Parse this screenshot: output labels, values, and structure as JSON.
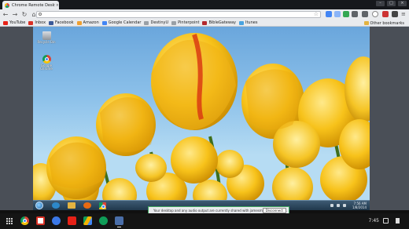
{
  "browser": {
    "tab_title": "Chrome Remote Deskto",
    "tab_close": "×",
    "window_buttons": [
      "–",
      "□",
      "×"
    ],
    "nav": {
      "back": "←",
      "forward": "→",
      "reload": "↻",
      "home": "⌂"
    },
    "address_value": "",
    "star": "☆"
  },
  "bookmarks": [
    {
      "label": "YouTube",
      "color": "#e62117"
    },
    {
      "label": "Inbox",
      "color": "#d93025"
    },
    {
      "label": "Facebook",
      "color": "#3b5998"
    },
    {
      "label": "Amazon",
      "color": "#f0a030"
    },
    {
      "label": "Google Calendar",
      "color": "#4285f4"
    },
    {
      "label": "DestinyU",
      "color": "#9aa0a6"
    },
    {
      "label": "Pinterpoint",
      "color": "#9aa0a6"
    },
    {
      "label": "BibleGateway",
      "color": "#b3282d"
    },
    {
      "label": "Itunes",
      "color": "#4aa3df"
    }
  ],
  "other_bookmarks": "Other bookmarks",
  "remote_desktop": {
    "icons": [
      {
        "label": "Recycle Bin"
      },
      {
        "label": "Google Chrome"
      }
    ],
    "clock_time": "7:56 AM",
    "clock_date": "1/8/2014",
    "share_text": "Your desktop and any audio output are currently shared with jamesmith@gmail.com.",
    "disconnect_label": "Disconnect"
  },
  "shelf": {
    "time": "7:45",
    "apps": [
      {
        "name": "chrome",
        "color": "#db4437"
      },
      {
        "name": "gmail",
        "color": "#d93025"
      },
      {
        "name": "search",
        "color": "#3b78e7"
      },
      {
        "name": "youtube",
        "color": "#e62117"
      },
      {
        "name": "drive",
        "color": "#0f9d58"
      },
      {
        "name": "hangouts",
        "color": "#0f9d58"
      },
      {
        "name": "remote-desktop",
        "color": "#4a6ea9"
      }
    ]
  }
}
